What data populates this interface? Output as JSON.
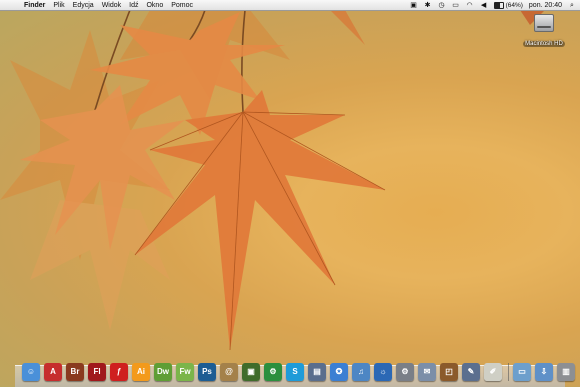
{
  "menubar": {
    "apple_glyph": "",
    "app_name": "Finder",
    "items": [
      "Plik",
      "Edycja",
      "Widok",
      "Idź",
      "Okno",
      "Pomoc"
    ],
    "status": {
      "battery_percent_label": "(64%)",
      "battery_level": 0.64,
      "clock": "pon. 20:40"
    }
  },
  "desktop": {
    "hd_label": "Macintosh HD"
  },
  "dock": {
    "apps": [
      {
        "icon": "finder-icon",
        "glyph": "☺",
        "color": "#4a90d9"
      },
      {
        "icon": "acrobat-icon",
        "glyph": "A",
        "color": "#c62d2d"
      },
      {
        "icon": "bridge-icon",
        "glyph": "Br",
        "color": "#8a3a1f"
      },
      {
        "icon": "flash-icon",
        "glyph": "Fl",
        "color": "#a0181c"
      },
      {
        "icon": "flash-player-icon",
        "glyph": "ƒ",
        "color": "#cf1f1f"
      },
      {
        "icon": "illustrator-icon",
        "glyph": "Ai",
        "color": "#f39a1c"
      },
      {
        "icon": "dreamweaver-icon",
        "glyph": "Dw",
        "color": "#5f9e35"
      },
      {
        "icon": "fireworks-icon",
        "glyph": "Fw",
        "color": "#7bb54a"
      },
      {
        "icon": "photoshop-icon",
        "glyph": "Ps",
        "color": "#1d5d93"
      },
      {
        "icon": "address-book-icon",
        "glyph": "@",
        "color": "#a4814a"
      },
      {
        "icon": "iphoto-icon",
        "glyph": "▣",
        "color": "#3f6c2b"
      },
      {
        "icon": "automator-icon",
        "glyph": "⚙",
        "color": "#2b8f3e"
      },
      {
        "icon": "skype-icon",
        "glyph": "S",
        "color": "#1e9bd8"
      },
      {
        "icon": "preview-icon",
        "glyph": "▤",
        "color": "#5a6e8d"
      },
      {
        "icon": "safari-icon",
        "glyph": "✪",
        "color": "#3b7fd3"
      },
      {
        "icon": "itunes-icon",
        "glyph": "♫",
        "color": "#4d86c4"
      },
      {
        "icon": "ical-icon",
        "glyph": "☼",
        "color": "#2b68b5"
      },
      {
        "icon": "system-preferences-icon",
        "glyph": "⚙",
        "color": "#7a7f87"
      },
      {
        "icon": "mail-icon",
        "glyph": "✉",
        "color": "#7b8ea8"
      }
    ],
    "utilities": [
      {
        "icon": "stamp-icon",
        "glyph": "◰",
        "color": "#8b5a2b"
      },
      {
        "icon": "pencil-icon",
        "glyph": "✎",
        "color": "#5b6f8f"
      },
      {
        "icon": "notes-icon",
        "glyph": "✐",
        "color": "#cfcfc5"
      }
    ],
    "stacks": [
      {
        "icon": "folder-icon",
        "glyph": "▭",
        "color": "#6d9fcc"
      },
      {
        "icon": "downloads-icon",
        "glyph": "⇩",
        "color": "#5f90c8"
      },
      {
        "icon": "trash-icon",
        "glyph": "▥",
        "color": "#8d8f93"
      }
    ]
  }
}
